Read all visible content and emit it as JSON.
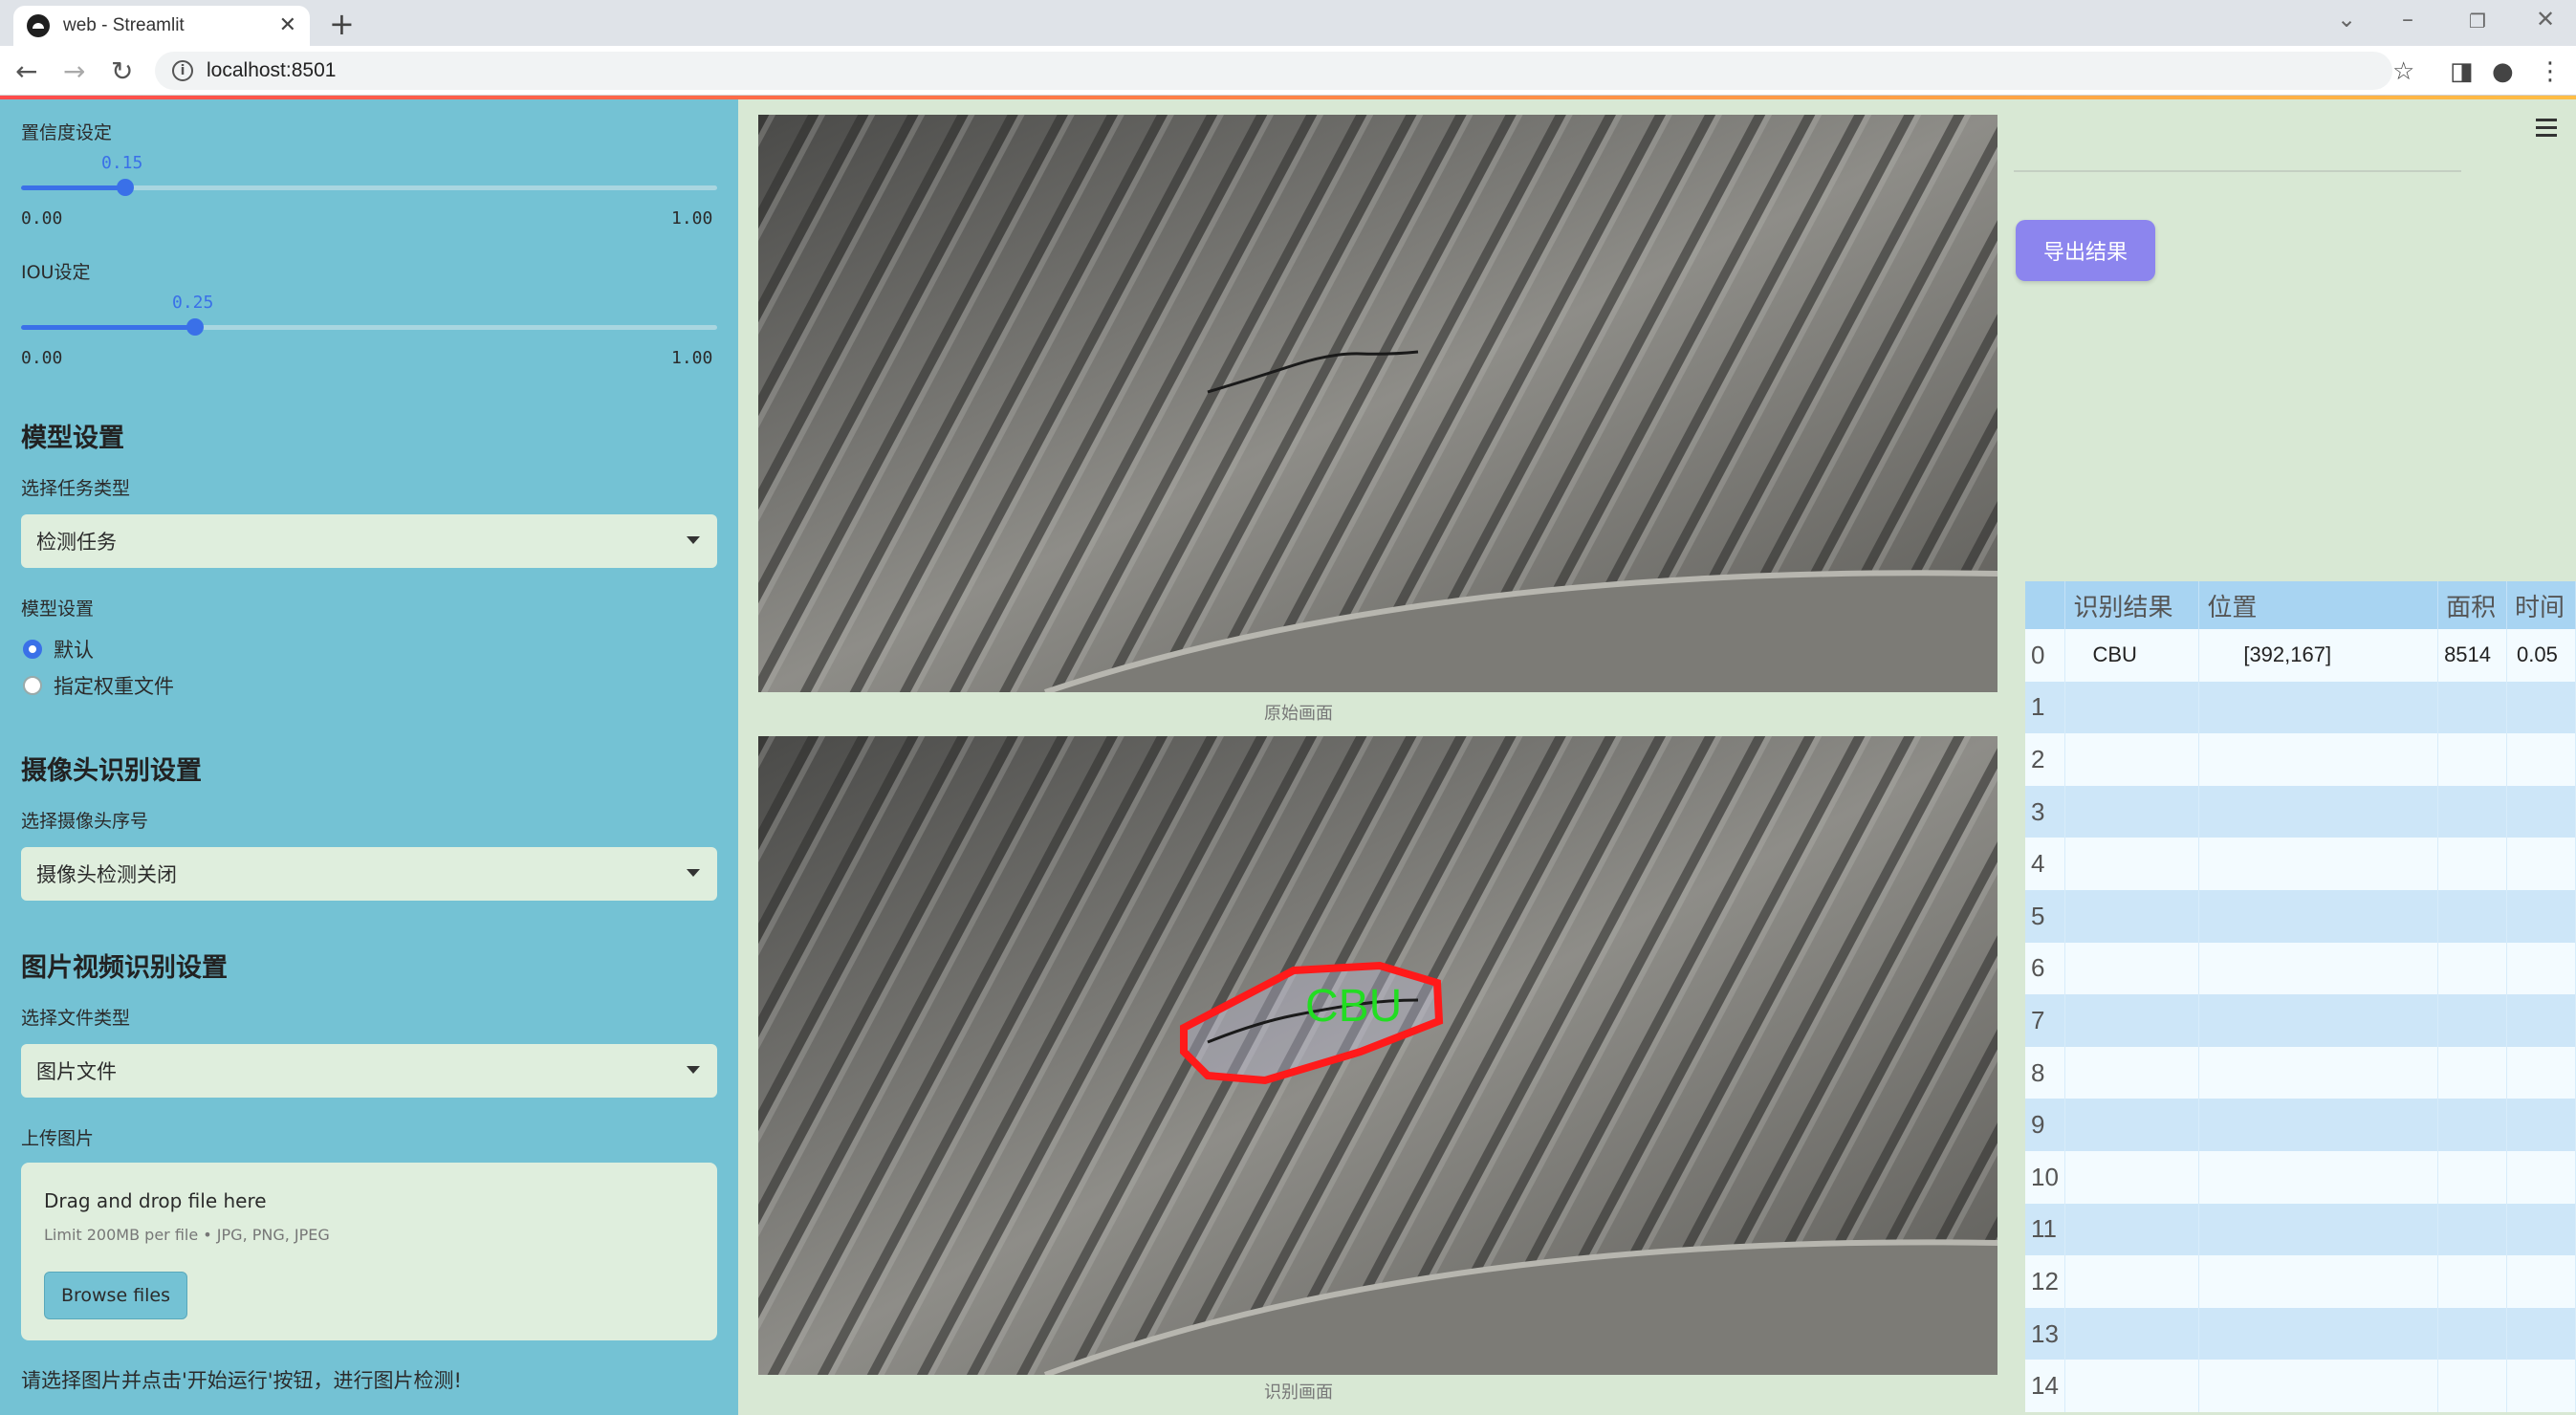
{
  "browser": {
    "tab_title": "web - Streamlit",
    "url": "localhost:8501"
  },
  "sidebar": {
    "confidence": {
      "label": "置信度设定",
      "value": "0.15",
      "min": "0.00",
      "max": "1.00",
      "fraction": 0.15
    },
    "iou": {
      "label": "IOU设定",
      "value": "0.25",
      "min": "0.00",
      "max": "1.00",
      "fraction": 0.25
    },
    "model_section_title": "模型设置",
    "task_type_label": "选择任务类型",
    "task_type_value": "检测任务",
    "model_setting_label": "模型设置",
    "model_options": [
      "默认",
      "指定权重文件"
    ],
    "model_selected": "默认",
    "camera_section_title": "摄像头识别设置",
    "camera_select_label": "选择摄像头序号",
    "camera_select_value": "摄像头检测关闭",
    "media_section_title": "图片视频识别设置",
    "file_type_label": "选择文件类型",
    "file_type_value": "图片文件",
    "upload_label": "上传图片",
    "upload_drag_text": "Drag and drop file here",
    "upload_limit_text": "Limit 200MB per file • JPG, PNG, JPEG",
    "browse_button": "Browse files",
    "hint_text": "请选择图片并点击'开始运行'按钮，进行图片检测!"
  },
  "main": {
    "original_caption": "原始画面",
    "detected_caption": "识别画面",
    "detection_label": "CBU"
  },
  "right": {
    "export_button": "导出结果",
    "table": {
      "columns": [
        "",
        "识别结果",
        "位置",
        "面积",
        "时间"
      ],
      "rows": [
        {
          "index": "0",
          "result": "CBU",
          "position": "[392,167]",
          "area": "8514",
          "time": "0.05"
        },
        {
          "index": "1",
          "result": "",
          "position": "",
          "area": "",
          "time": ""
        },
        {
          "index": "2",
          "result": "",
          "position": "",
          "area": "",
          "time": ""
        },
        {
          "index": "3",
          "result": "",
          "position": "",
          "area": "",
          "time": ""
        },
        {
          "index": "4",
          "result": "",
          "position": "",
          "area": "",
          "time": ""
        },
        {
          "index": "5",
          "result": "",
          "position": "",
          "area": "",
          "time": ""
        },
        {
          "index": "6",
          "result": "",
          "position": "",
          "area": "",
          "time": ""
        },
        {
          "index": "7",
          "result": "",
          "position": "",
          "area": "",
          "time": ""
        },
        {
          "index": "8",
          "result": "",
          "position": "",
          "area": "",
          "time": ""
        },
        {
          "index": "9",
          "result": "",
          "position": "",
          "area": "",
          "time": ""
        },
        {
          "index": "10",
          "result": "",
          "position": "",
          "area": "",
          "time": ""
        },
        {
          "index": "11",
          "result": "",
          "position": "",
          "area": "",
          "time": ""
        },
        {
          "index": "12",
          "result": "",
          "position": "",
          "area": "",
          "time": ""
        },
        {
          "index": "13",
          "result": "",
          "position": "",
          "area": "",
          "time": ""
        },
        {
          "index": "14",
          "result": "",
          "position": "",
          "area": "",
          "time": ""
        }
      ]
    }
  },
  "icons": [
    "streamlit-favicon",
    "close-icon",
    "plus-icon",
    "back-icon",
    "forward-icon",
    "reload-icon",
    "info-icon",
    "star-icon",
    "sidepanel-icon",
    "profile-icon",
    "kebab-menu-icon",
    "hamburger-menu-icon",
    "chevron-down-icon"
  ],
  "colors": {
    "sidebar": "#74c2d4",
    "main_bg": "#d8e8d4",
    "accent": "#3a70e8",
    "export_button": "#8c85ee",
    "table_header": "#a8d4f2",
    "detection_box": "#ff1a1a",
    "detection_text": "#22dd22"
  }
}
